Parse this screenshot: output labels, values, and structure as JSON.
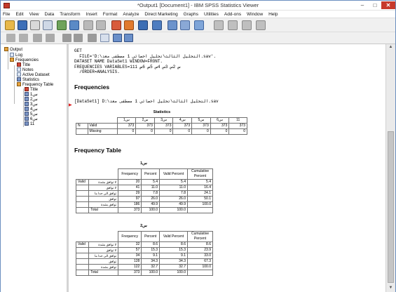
{
  "window": {
    "title": "*Output1 [Document1] - IBM SPSS Statistics Viewer"
  },
  "menu": [
    "File",
    "Edit",
    "View",
    "Data",
    "Transform",
    "Insert",
    "Format",
    "Analyze",
    "Direct Marketing",
    "Graphs",
    "Utilities",
    "Add-ons",
    "Window",
    "Help"
  ],
  "nav": {
    "output": "Output",
    "log": "Log",
    "frequencies": "Frequencies",
    "title": "Title",
    "notes": "Notes",
    "active_dataset": "Active Dataset",
    "statistics": "Statistics",
    "frequency_table": "Frequency Table",
    "title2": "Title",
    "items": [
      "1ﺱ",
      "2ﺱ",
      "3ﺱ",
      "4ﺱ",
      "5ﺱ",
      "6ﺱ",
      "11"
    ]
  },
  "syntax": {
    "line1": "GET",
    "line2": "  FILE='D:\\التحليل الثالث\\تحليل احصائي 1 مصطفى معد.sav'.",
    "line3": "DATASET NAME DataSet1 WINDOW=FRONT.",
    "line4": "FREQUENCIES VARIABLES=1ﺱ 2ﺱ 3ﺱ 4ﺱ 5ﺱ 6ﺱ 11",
    "line5": "  /ORDER=ANALYSIS."
  },
  "frequencies_heading": "Frequencies",
  "dataset_line": "[DataSet1] D:\\التحليل الثالث\\تحليل احصائي 1 مصطفى معد.sav",
  "statistics": {
    "caption": "Statistics",
    "columns": [
      "1ﺱ",
      "2ﺱ",
      "3ﺱ",
      "4ﺱ",
      "5ﺱ",
      "6ﺱ",
      "11"
    ],
    "row_n": "N",
    "valid_label": "Valid",
    "missing_label": "Missing",
    "valid": [
      "373",
      "373",
      "373",
      "373",
      "373",
      "373",
      "373"
    ],
    "missing": [
      "0",
      "0",
      "0",
      "0",
      "0",
      "0",
      "0"
    ]
  },
  "freq_table_heading": "Frequency Table",
  "freq_headers": {
    "frequency": "Frequency",
    "percent": "Percent",
    "valid_percent": "Valid Percent",
    "cumulative": "Cumulative Percent"
  },
  "valid_label": "Valid",
  "total_label": "Total",
  "tables": [
    {
      "caption": "1ﺱ",
      "rows": [
        {
          "label": "لا توافق بشدة",
          "freq": "20",
          "pct": "5.4",
          "vpct": "5.4",
          "cum": "5.4"
        },
        {
          "label": "لا توافق",
          "freq": "41",
          "pct": "11.0",
          "vpct": "11.0",
          "cum": "16.4"
        },
        {
          "label": "توافق الى حدا ما",
          "freq": "29",
          "pct": "7.8",
          "vpct": "7.8",
          "cum": "24.1"
        },
        {
          "label": "توافق",
          "freq": "97",
          "pct": "26.0",
          "vpct": "26.0",
          "cum": "50.1"
        },
        {
          "label": "توافق بشدة",
          "freq": "186",
          "pct": "49.9",
          "vpct": "49.9",
          "cum": "100.0"
        }
      ],
      "total": {
        "freq": "373",
        "pct": "100.0",
        "vpct": "100.0"
      }
    },
    {
      "caption": "2ﺱ",
      "rows": [
        {
          "label": "لا توافق بشدة",
          "freq": "32",
          "pct": "8.6",
          "vpct": "8.6",
          "cum": "8.6"
        },
        {
          "label": "لا توافق",
          "freq": "57",
          "pct": "15.3",
          "vpct": "15.3",
          "cum": "23.9"
        },
        {
          "label": "توافق الى حدا ما",
          "freq": "34",
          "pct": "9.1",
          "vpct": "9.1",
          "cum": "33.0"
        },
        {
          "label": "توافق",
          "freq": "128",
          "pct": "34.3",
          "vpct": "34.3",
          "cum": "67.3"
        },
        {
          "label": "توافق بشدة",
          "freq": "122",
          "pct": "32.7",
          "vpct": "32.7",
          "cum": "100.0"
        }
      ],
      "total": {
        "freq": "373",
        "pct": "100.0",
        "vpct": "100.0"
      }
    }
  ],
  "icons": [
    "open-icon",
    "save-icon",
    "print-icon",
    "print-preview-icon",
    "export-icon",
    "recall-dialog-icon",
    "undo-icon",
    "redo-icon",
    "goto-data-icon",
    "goto-case-icon",
    "goto-variable-icon",
    "variables-icon",
    "create-title-icon",
    "select-last-output-icon",
    "designate-window-icon",
    "promote-icon",
    "demote-icon",
    "expand-icon",
    "collapse-icon",
    "show-icon",
    "hide-icon",
    "insert-heading-icon",
    "insert-title-icon",
    "insert-text-icon"
  ]
}
